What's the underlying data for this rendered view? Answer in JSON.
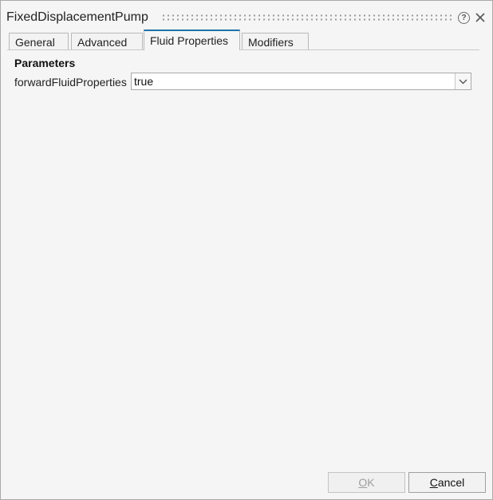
{
  "window": {
    "title": "FixedDisplacementPump",
    "help_icon": "question-circle-icon",
    "help_glyph": "?",
    "close_icon": "close-icon"
  },
  "tabs": [
    {
      "label": "General",
      "active": false
    },
    {
      "label": "Advanced",
      "active": false
    },
    {
      "label": "Fluid Properties",
      "active": true
    },
    {
      "label": "Modifiers",
      "active": false
    }
  ],
  "parameters": {
    "section_title": "Parameters",
    "rows": [
      {
        "label": "forwardFluidProperties",
        "value": "true"
      }
    ]
  },
  "buttons": {
    "ok": {
      "mnemonic": "O",
      "rest": "K",
      "enabled": false
    },
    "cancel": {
      "mnemonic": "C",
      "rest": "ancel",
      "enabled": true
    }
  },
  "colors": {
    "active_tab_accent": "#1e73a8",
    "dialog_background": "#f5f5f5"
  }
}
